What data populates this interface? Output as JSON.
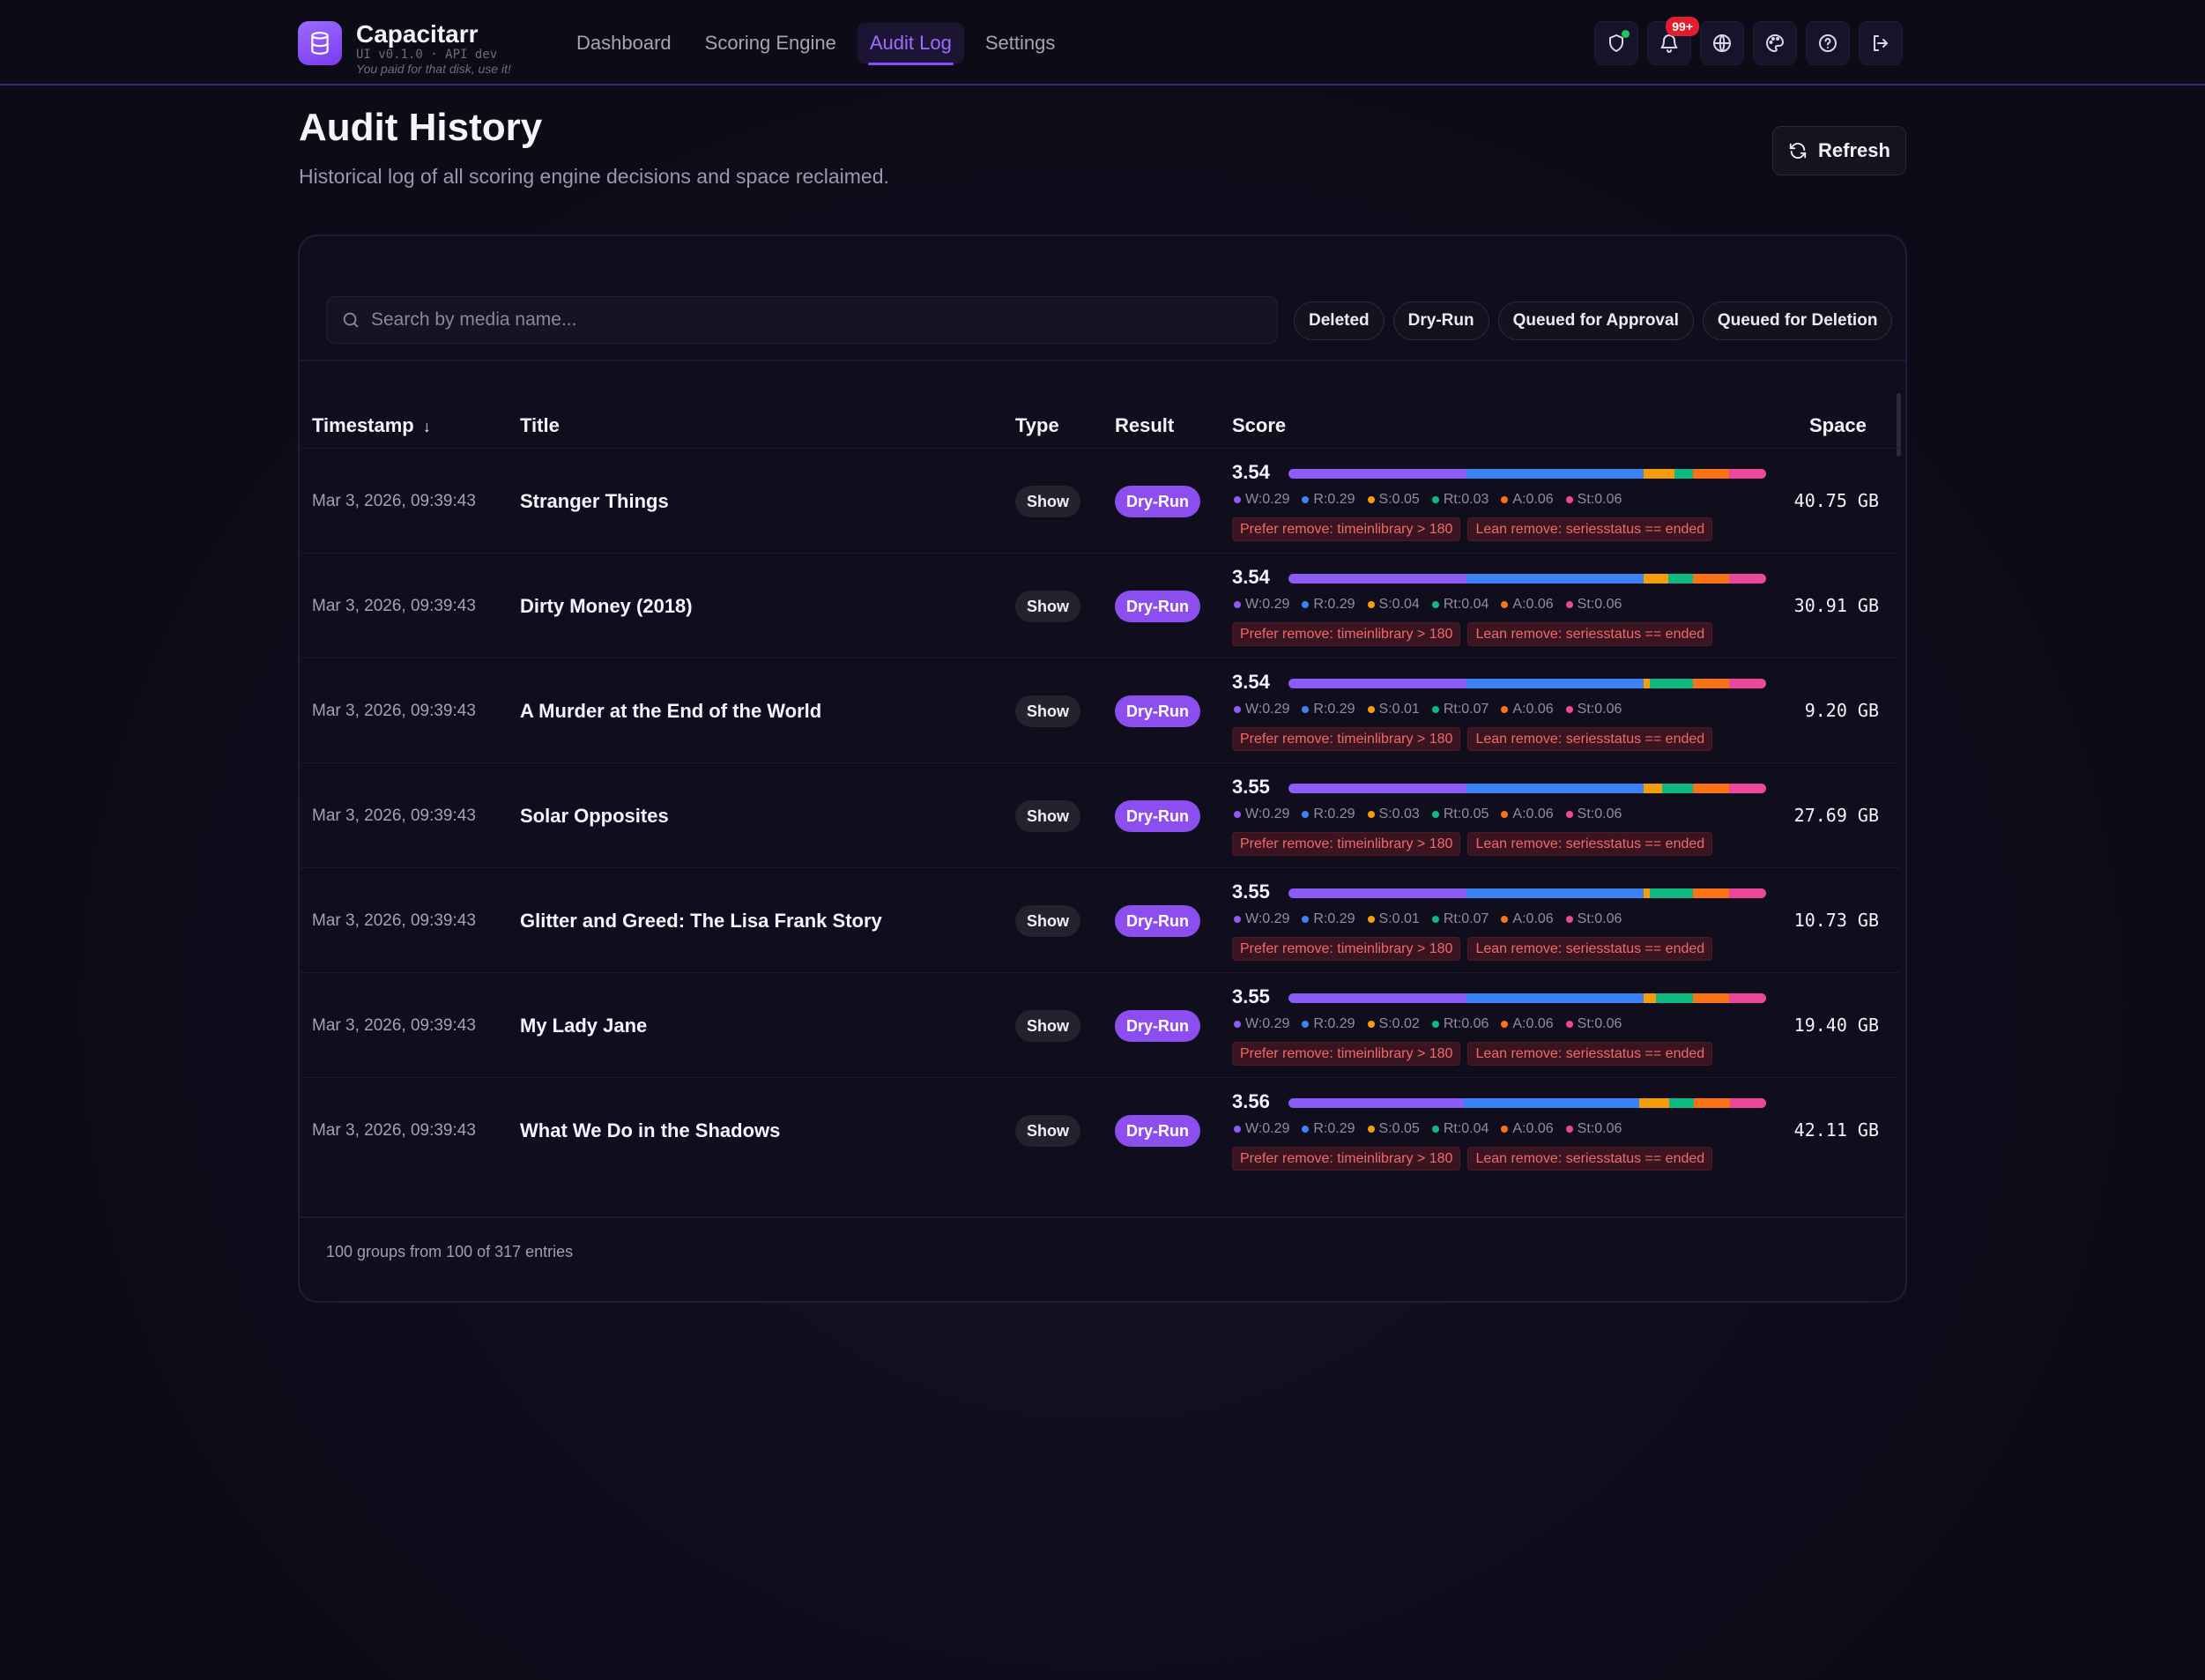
{
  "app": {
    "name": "Capacitarr",
    "version": "UI v0.1.0 · API dev",
    "tagline": "You paid for that disk, use it!"
  },
  "nav": [
    {
      "label": "Dashboard",
      "active": false
    },
    {
      "label": "Scoring Engine",
      "active": false
    },
    {
      "label": "Audit Log",
      "active": true
    },
    {
      "label": "Settings",
      "active": false
    }
  ],
  "header_actions": {
    "notification_badge": "99+",
    "icons": [
      "shield-icon",
      "bell-icon",
      "globe-icon",
      "palette-icon",
      "help-icon",
      "logout-icon"
    ]
  },
  "page": {
    "title": "Audit History",
    "subtitle": "Historical log of all scoring engine decisions and space reclaimed.",
    "refresh_label": "Refresh"
  },
  "search": {
    "placeholder": "Search by media name...",
    "value": ""
  },
  "filters": [
    "Deleted",
    "Dry-Run",
    "Queued for Approval",
    "Queued for Deletion"
  ],
  "table": {
    "columns": [
      "Timestamp",
      "Title",
      "Type",
      "Result",
      "Score",
      "Space"
    ],
    "sort_indicator": "↓",
    "rows": [
      {
        "timestamp": "Mar 3, 2026, 09:39:43",
        "title": "Stranger Things",
        "type": "Show",
        "result": "Dry-Run",
        "score": "3.54",
        "factors": [
          "W:0.29",
          "R:0.29",
          "S:0.05",
          "Rt:0.03",
          "A:0.06",
          "St:0.06"
        ],
        "reasons": [
          "Prefer remove: timeinlibrary > 180",
          "Lean remove: seriesstatus == ended"
        ],
        "space": "40.75 GB"
      },
      {
        "timestamp": "Mar 3, 2026, 09:39:43",
        "title": "Dirty Money (2018)",
        "type": "Show",
        "result": "Dry-Run",
        "score": "3.54",
        "factors": [
          "W:0.29",
          "R:0.29",
          "S:0.04",
          "Rt:0.04",
          "A:0.06",
          "St:0.06"
        ],
        "reasons": [
          "Prefer remove: timeinlibrary > 180",
          "Lean remove: seriesstatus == ended"
        ],
        "space": "30.91 GB"
      },
      {
        "timestamp": "Mar 3, 2026, 09:39:43",
        "title": "A Murder at the End of the World",
        "type": "Show",
        "result": "Dry-Run",
        "score": "3.54",
        "factors": [
          "W:0.29",
          "R:0.29",
          "S:0.01",
          "Rt:0.07",
          "A:0.06",
          "St:0.06"
        ],
        "reasons": [
          "Prefer remove: timeinlibrary > 180",
          "Lean remove: seriesstatus == ended"
        ],
        "space": "9.20 GB"
      },
      {
        "timestamp": "Mar 3, 2026, 09:39:43",
        "title": "Solar Opposites",
        "type": "Show",
        "result": "Dry-Run",
        "score": "3.55",
        "factors": [
          "W:0.29",
          "R:0.29",
          "S:0.03",
          "Rt:0.05",
          "A:0.06",
          "St:0.06"
        ],
        "reasons": [
          "Prefer remove: timeinlibrary > 180",
          "Lean remove: seriesstatus == ended"
        ],
        "space": "27.69 GB"
      },
      {
        "timestamp": "Mar 3, 2026, 09:39:43",
        "title": "Glitter and Greed: The Lisa Frank Story",
        "type": "Show",
        "result": "Dry-Run",
        "score": "3.55",
        "factors": [
          "W:0.29",
          "R:0.29",
          "S:0.01",
          "Rt:0.07",
          "A:0.06",
          "St:0.06"
        ],
        "reasons": [
          "Prefer remove: timeinlibrary > 180",
          "Lean remove: seriesstatus == ended"
        ],
        "space": "10.73 GB"
      },
      {
        "timestamp": "Mar 3, 2026, 09:39:43",
        "title": "My Lady Jane",
        "type": "Show",
        "result": "Dry-Run",
        "score": "3.55",
        "factors": [
          "W:0.29",
          "R:0.29",
          "S:0.02",
          "Rt:0.06",
          "A:0.06",
          "St:0.06"
        ],
        "reasons": [
          "Prefer remove: timeinlibrary > 180",
          "Lean remove: seriesstatus == ended"
        ],
        "space": "19.40 GB"
      },
      {
        "timestamp": "Mar 3, 2026, 09:39:43",
        "title": "What We Do in the Shadows",
        "type": "Show",
        "result": "Dry-Run",
        "score": "3.56",
        "factors": [
          "W:0.29",
          "R:0.29",
          "S:0.05",
          "Rt:0.04",
          "A:0.06",
          "St:0.06"
        ],
        "reasons": [
          "Prefer remove: timeinlibrary > 180",
          "Lean remove: seriesstatus == ended"
        ],
        "space": "42.11 GB"
      }
    ]
  },
  "factor_colors": [
    "#8b5cf6",
    "#3b82f6",
    "#f59e0b",
    "#10b981",
    "#f97316",
    "#ec4899"
  ],
  "footer": "100 groups from 100 of 317 entries"
}
